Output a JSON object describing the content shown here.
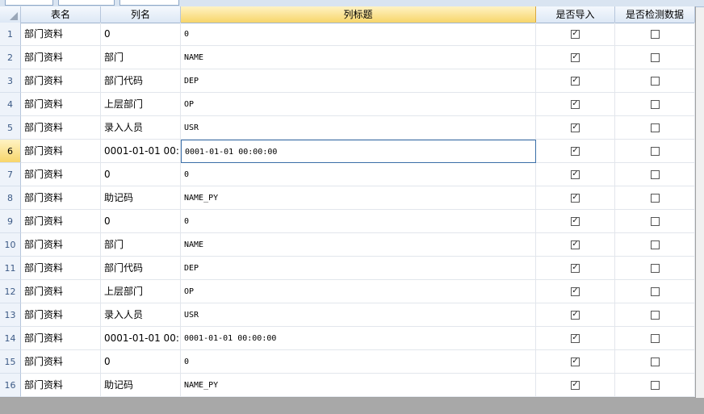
{
  "columns": {
    "table_name": "表名",
    "column_name": "列名",
    "column_title": "列标题",
    "is_import": "是否导入",
    "is_check": "是否检测数据"
  },
  "rows": [
    {
      "num": "1",
      "table": "部门资料",
      "col": "0",
      "title": "0",
      "import": true,
      "check": false
    },
    {
      "num": "2",
      "table": "部门资料",
      "col": "部门",
      "title": "NAME",
      "import": true,
      "check": false
    },
    {
      "num": "3",
      "table": "部门资料",
      "col": "部门代码",
      "title": "DEP",
      "import": true,
      "check": false
    },
    {
      "num": "4",
      "table": "部门资料",
      "col": "上层部门",
      "title": "OP",
      "import": true,
      "check": false
    },
    {
      "num": "5",
      "table": "部门资料",
      "col": "录入人员",
      "title": "USR",
      "import": true,
      "check": false
    },
    {
      "num": "6",
      "table": "部门资料",
      "col": "0001-01-01 00:",
      "title": "0001-01-01 00:00:00",
      "import": true,
      "check": false
    },
    {
      "num": "7",
      "table": "部门资料",
      "col": "0",
      "title": "0",
      "import": true,
      "check": false
    },
    {
      "num": "8",
      "table": "部门资料",
      "col": "助记码",
      "title": "NAME_PY",
      "import": true,
      "check": false
    },
    {
      "num": "9",
      "table": "部门资料",
      "col": "0",
      "title": "0",
      "import": true,
      "check": false
    },
    {
      "num": "10",
      "table": "部门资料",
      "col": "部门",
      "title": "NAME",
      "import": true,
      "check": false
    },
    {
      "num": "11",
      "table": "部门资料",
      "col": "部门代码",
      "title": "DEP",
      "import": true,
      "check": false
    },
    {
      "num": "12",
      "table": "部门资料",
      "col": "上层部门",
      "title": "OP",
      "import": true,
      "check": false
    },
    {
      "num": "13",
      "table": "部门资料",
      "col": "录入人员",
      "title": "USR",
      "import": true,
      "check": false
    },
    {
      "num": "14",
      "table": "部门资料",
      "col": "0001-01-01 00:",
      "title": "0001-01-01 00:00:00",
      "import": true,
      "check": false
    },
    {
      "num": "15",
      "table": "部门资料",
      "col": "0",
      "title": "0",
      "import": true,
      "check": false
    },
    {
      "num": "16",
      "table": "部门资料",
      "col": "助记码",
      "title": "NAME_PY",
      "import": true,
      "check": false
    }
  ],
  "active_row": "6"
}
